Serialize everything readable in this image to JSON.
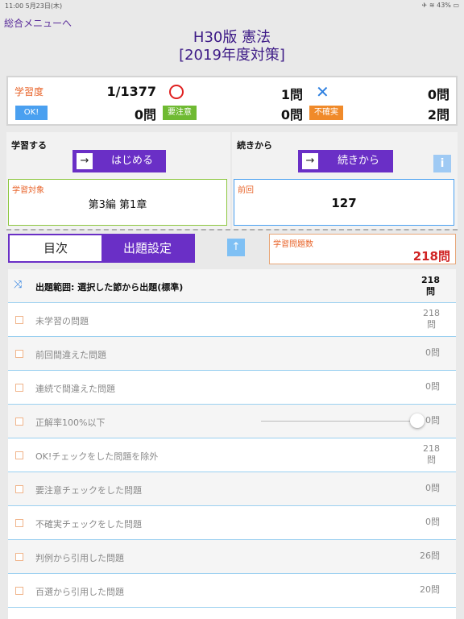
{
  "statusbar": {
    "time_date": "11:00  5月23日(木)",
    "right": "✈ ≋ 43% ▭"
  },
  "header": {
    "back": "総合メニューへ",
    "title_line1": "H30版 憲法",
    "title_line2": "[2019年度対策]"
  },
  "stats": {
    "label": "学習度",
    "progress": "1/1377",
    "correct": "1問",
    "wrong": "0問",
    "ok_chip": "OK!",
    "ok_count": "0問",
    "attention_chip": "要注意",
    "attention_count": "0問",
    "uncertain_chip": "不確実",
    "uncertain_count": "2問"
  },
  "study": {
    "heading": "学習する",
    "start_button": "はじめる",
    "target_label": "学習対象",
    "target_value": "第3編 第1章"
  },
  "resume": {
    "heading": "続きから",
    "button": "続きから",
    "info": "i",
    "prev_label": "前回",
    "prev_value": "127"
  },
  "tabs": {
    "index": "目次",
    "settings": "出題設定"
  },
  "up_button": "↑",
  "count": {
    "label": "学習問題数",
    "value": "218問"
  },
  "list": {
    "header": {
      "label": "出題範囲: 選択した節から出題(標準)",
      "value": "218\n問"
    },
    "rows": [
      {
        "label": "未学習の問題",
        "value": "218\n問"
      },
      {
        "label": "前回間違えた問題",
        "value": "0問"
      },
      {
        "label": "連続で間違えた問題",
        "value": "0問"
      },
      {
        "label": "正解率100%以下",
        "value": "0問"
      },
      {
        "label": "OK!チェックをした問題を除外",
        "value": "218\n問"
      },
      {
        "label": "要注意チェックをした問題",
        "value": "0問"
      },
      {
        "label": "不確実チェックをした問題",
        "value": "0問"
      },
      {
        "label": "判例から引用した問題",
        "value": "26問"
      },
      {
        "label": "百選から引用した問題",
        "value": "20問"
      }
    ]
  },
  "colors": {
    "accent": "#6a2fc6",
    "orange": "#e8642a",
    "red": "#d02424",
    "blue": "#2c7fe0"
  }
}
